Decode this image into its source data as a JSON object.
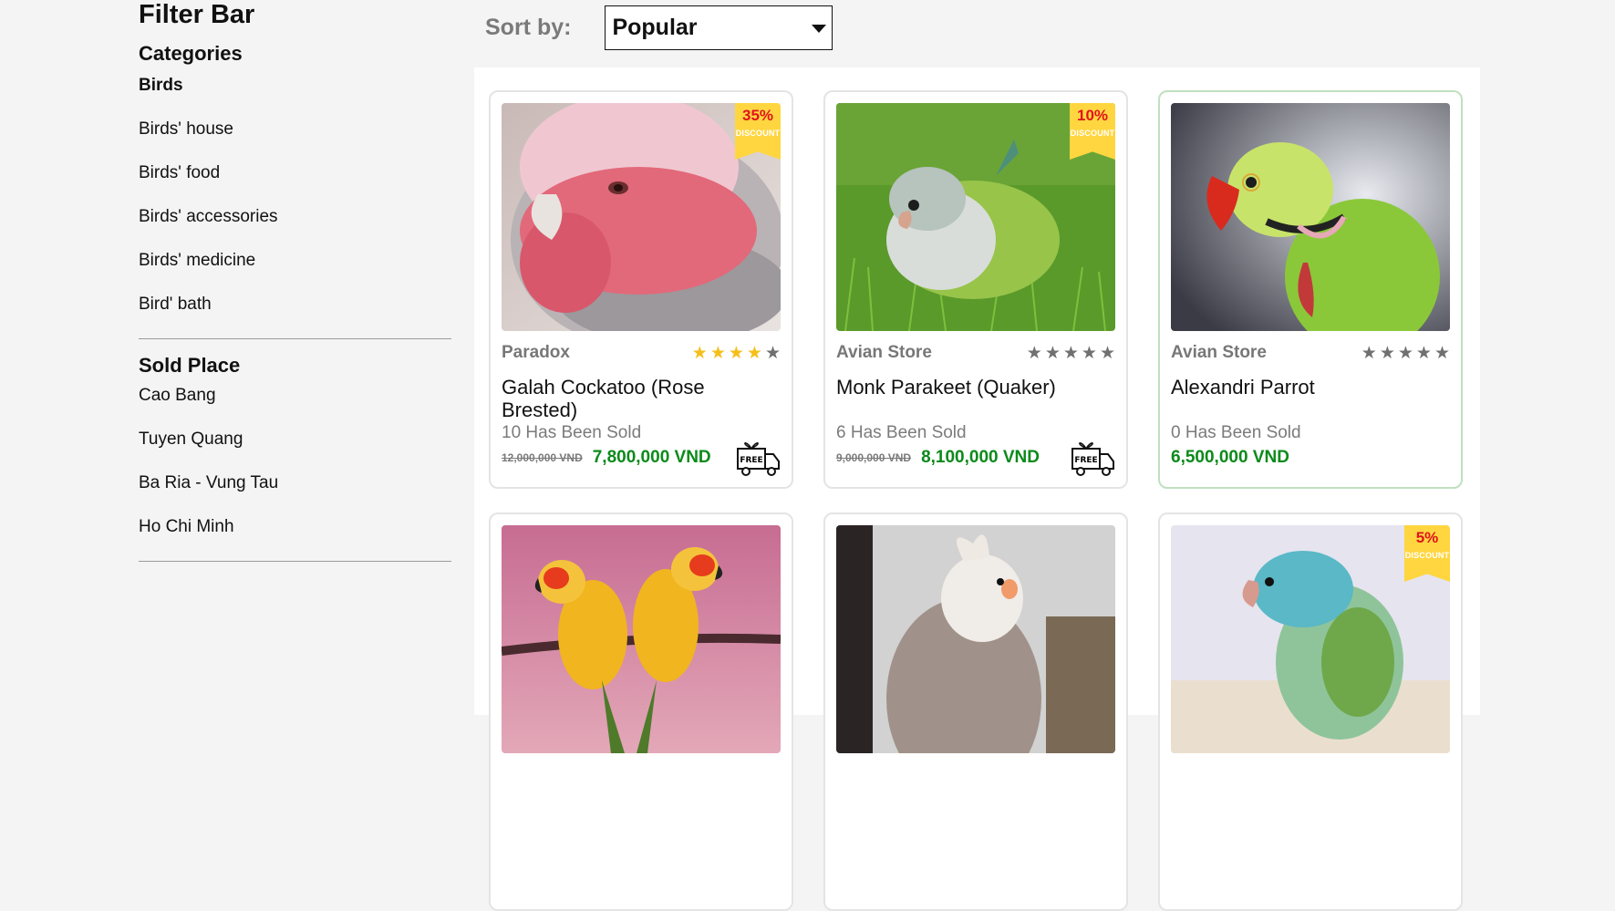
{
  "sidebar": {
    "title": "Filter Bar",
    "categories_heading": "Categories",
    "categories": [
      {
        "label": "Birds",
        "active": true
      },
      {
        "label": "Birds' house"
      },
      {
        "label": "Birds' food"
      },
      {
        "label": "Birds' accessories"
      },
      {
        "label": "Birds' medicine"
      },
      {
        "label": "Bird' bath"
      }
    ],
    "sold_place_heading": "Sold Place",
    "places": [
      "Cao Bang",
      "Tuyen Quang",
      "Ba Ria - Vung Tau",
      "Ho Chi Minh"
    ]
  },
  "sort": {
    "label": "Sort by:",
    "value": "Popular"
  },
  "discount_word": "DISCOUNT",
  "free_ship_text": "FREE",
  "products": [
    {
      "shop": "Paradox",
      "rating": 4,
      "name": "Galah Cockatoo (Rose Brested)",
      "sold": "10 Has Been Sold",
      "old_price": "12,000,000 VND",
      "price": "7,800,000 VND",
      "discount": "35%",
      "free_ship": true,
      "image": "galah-cockatoo"
    },
    {
      "shop": "Avian Store",
      "rating": 0,
      "name": "Monk Parakeet (Quaker)",
      "sold": "6 Has Been Sold",
      "old_price": "9,000,000 VND",
      "price": "8,100,000 VND",
      "discount": "10%",
      "free_ship": true,
      "image": "monk-parakeet"
    },
    {
      "shop": "Avian Store",
      "rating": 0,
      "name": "Alexandri Parrot",
      "sold": "0 Has Been Sold",
      "old_price": "",
      "price": "6,500,000 VND",
      "discount": "",
      "free_ship": false,
      "image": "alexandrine-parrot",
      "selected": true
    },
    {
      "shop": "",
      "rating": 0,
      "name": "",
      "sold": "",
      "old_price": "",
      "price": "",
      "discount": "",
      "free_ship": false,
      "image": "sun-conures"
    },
    {
      "shop": "",
      "rating": 0,
      "name": "",
      "sold": "",
      "old_price": "",
      "price": "",
      "discount": "",
      "free_ship": false,
      "image": "cockatiel"
    },
    {
      "shop": "",
      "rating": 0,
      "name": "",
      "sold": "",
      "old_price": "",
      "price": "",
      "discount": "5%",
      "free_ship": false,
      "image": "parrotlet"
    }
  ],
  "colors": {
    "price_green": "#0b8a1a",
    "badge_yellow": "#ffd640",
    "discount_red": "#e0131b",
    "star_gold": "#f5bf1a"
  }
}
